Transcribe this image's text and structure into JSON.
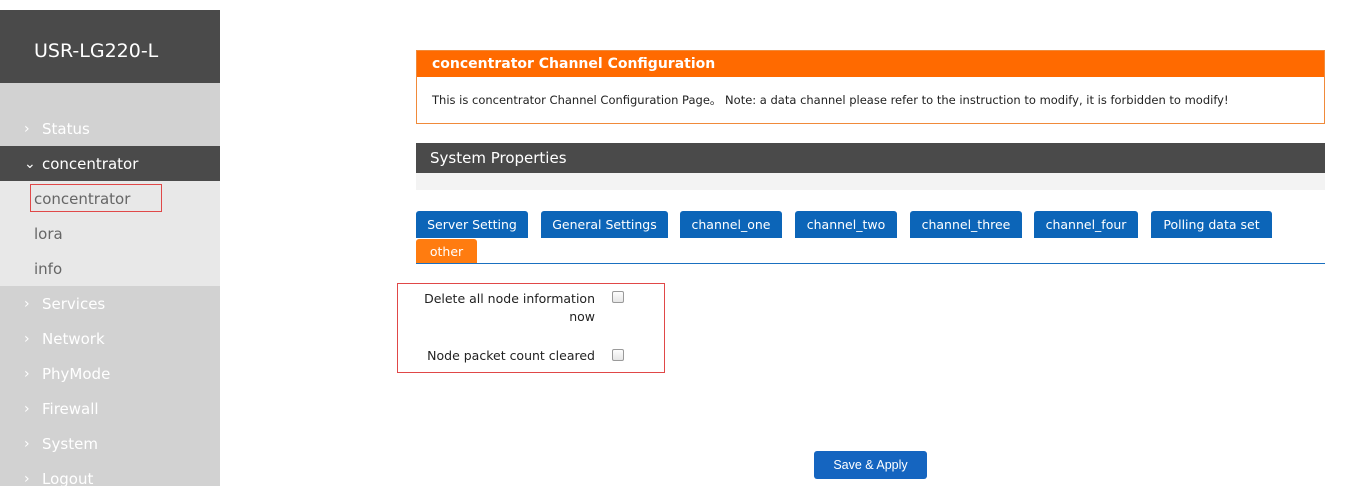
{
  "sidebar": {
    "brand": "USR-LG220-L",
    "items": [
      {
        "label": "Status"
      },
      {
        "label": "concentrator"
      },
      {
        "label": "Services"
      },
      {
        "label": "Network"
      },
      {
        "label": "PhyMode"
      },
      {
        "label": "Firewall"
      },
      {
        "label": "System"
      },
      {
        "label": "Logout"
      }
    ],
    "subitems": [
      {
        "label": "concentrator"
      },
      {
        "label": "lora"
      },
      {
        "label": "info"
      }
    ]
  },
  "notice": {
    "title": "concentrator Channel Configuration",
    "text": "This is concentrator Channel Configuration Page。 Note: a data channel please refer to the instruction to modify, it is forbidden to modify!"
  },
  "section": {
    "title": "System Properties"
  },
  "tabs": [
    {
      "label": "Server Setting"
    },
    {
      "label": "General Settings"
    },
    {
      "label": "channel_one"
    },
    {
      "label": "channel_two"
    },
    {
      "label": "channel_three"
    },
    {
      "label": "channel_four"
    },
    {
      "label": "Polling data set"
    },
    {
      "label": "other"
    }
  ],
  "options": {
    "delete_line1": "Delete all node information",
    "delete_line2": "now",
    "clear_count": "Node packet count cleared"
  },
  "actions": {
    "save_apply": "Save & Apply"
  },
  "colors": {
    "accent_orange": "#ff6a00",
    "tab_blue": "#0c65b8",
    "header_dark": "#4a4a4a"
  }
}
